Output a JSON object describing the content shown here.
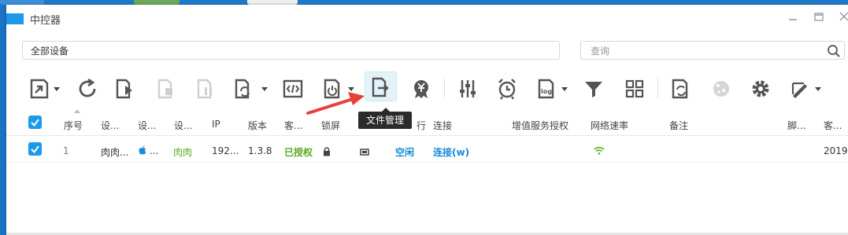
{
  "window": {
    "title": "中控器"
  },
  "filter": {
    "device_group": "全部设备",
    "search_placeholder": "查询"
  },
  "toolbar": {
    "items": [
      {
        "name": "import-icon",
        "dropdown": true
      },
      {
        "name": "refresh-icon"
      },
      {
        "name": "play-script-icon"
      },
      {
        "name": "stop-script-icon",
        "disabled": true
      },
      {
        "name": "pause-script-icon",
        "disabled": true
      },
      {
        "name": "sync-script-icon",
        "dropdown": true
      },
      {
        "name": "code-icon"
      },
      {
        "name": "power-icon",
        "dropdown": true
      },
      {
        "name": "file-manage-icon",
        "active": true
      },
      {
        "name": "yuan-icon"
      },
      {
        "name": "equalizer-icon"
      },
      {
        "name": "alarm-clock-icon"
      },
      {
        "name": "log-icon",
        "dropdown": true
      },
      {
        "name": "funnel-icon"
      },
      {
        "name": "grid-icon"
      },
      {
        "name": "transfer-icon"
      },
      {
        "name": "cookie-icon",
        "disabled": true
      },
      {
        "name": "gear-icon"
      },
      {
        "name": "pen-tool-icon",
        "dropdown": true
      }
    ],
    "tooltip": "文件管理"
  },
  "table": {
    "headers": [
      "序号",
      "设...",
      "设...",
      "设...",
      "IP",
      "版本",
      "客...",
      "锁屏",
      "行",
      "连接",
      "增值服务授权",
      "网络速率",
      "备注",
      "脚...",
      "客..."
    ],
    "rows": [
      {
        "index": "1",
        "device_name": "肉肉...",
        "device_os": "...",
        "device_group": "肉肉",
        "ip": "192...",
        "version": "1.3.8",
        "client_status": "已授权",
        "running": "空闲",
        "connection": "连接(w)",
        "client_date": "2019"
      }
    ]
  },
  "colors": {
    "accent": "#1a9ae8",
    "authorized": "#5aaa24",
    "link": "#1a8bd6",
    "arrow": "#e8403a"
  }
}
